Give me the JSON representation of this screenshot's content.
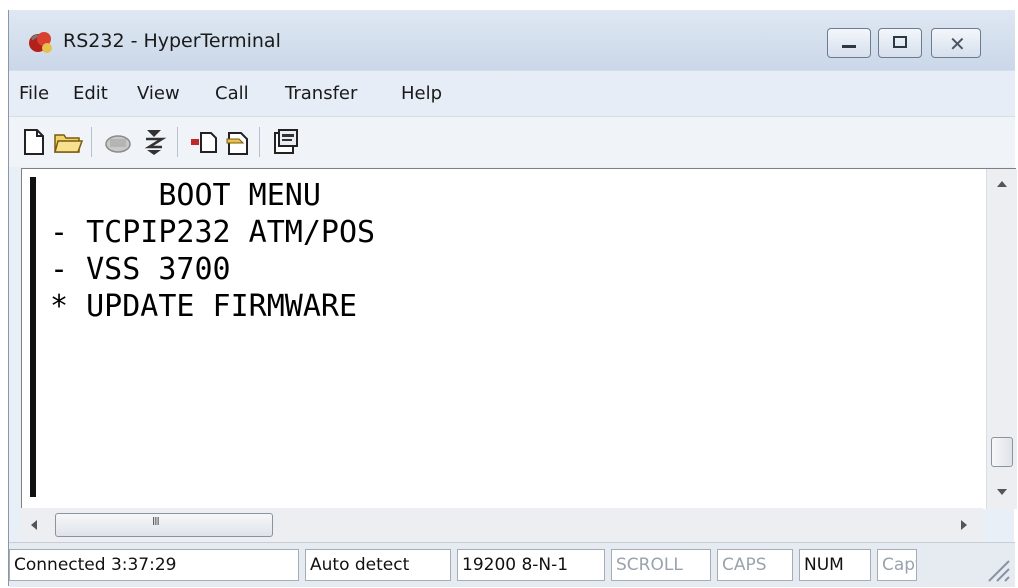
{
  "window": {
    "title": "RS232 - HyperTerminal"
  },
  "menu": [
    "File",
    "Edit",
    "View",
    "Call",
    "Transfer",
    "Help"
  ],
  "toolbar": {
    "icons": [
      "new-connection-icon",
      "open-icon",
      "disconnect-icon",
      "dial-icon",
      "send-icon",
      "receive-icon",
      "properties-icon"
    ]
  },
  "terminal": {
    "lines": [
      "      BOOT MENU",
      "- TCPIP232 ATM/POS",
      "- VSS 3700",
      "* UPDATE FIRMWARE"
    ]
  },
  "statusbar": {
    "connection": "Connected 3:37:29",
    "emulation": "Auto detect",
    "settings": "19200 8-N-1",
    "scroll": "SCROLL",
    "caps": "CAPS",
    "num": "NUM",
    "capture": "Capture"
  },
  "hscroll": {
    "thumb_glyph": "III"
  },
  "colors": {
    "titlebar": "#d7e2f0",
    "menubar": "#e6edf7",
    "terminal_bg": "#ffffff",
    "terminal_text": "#000000"
  }
}
